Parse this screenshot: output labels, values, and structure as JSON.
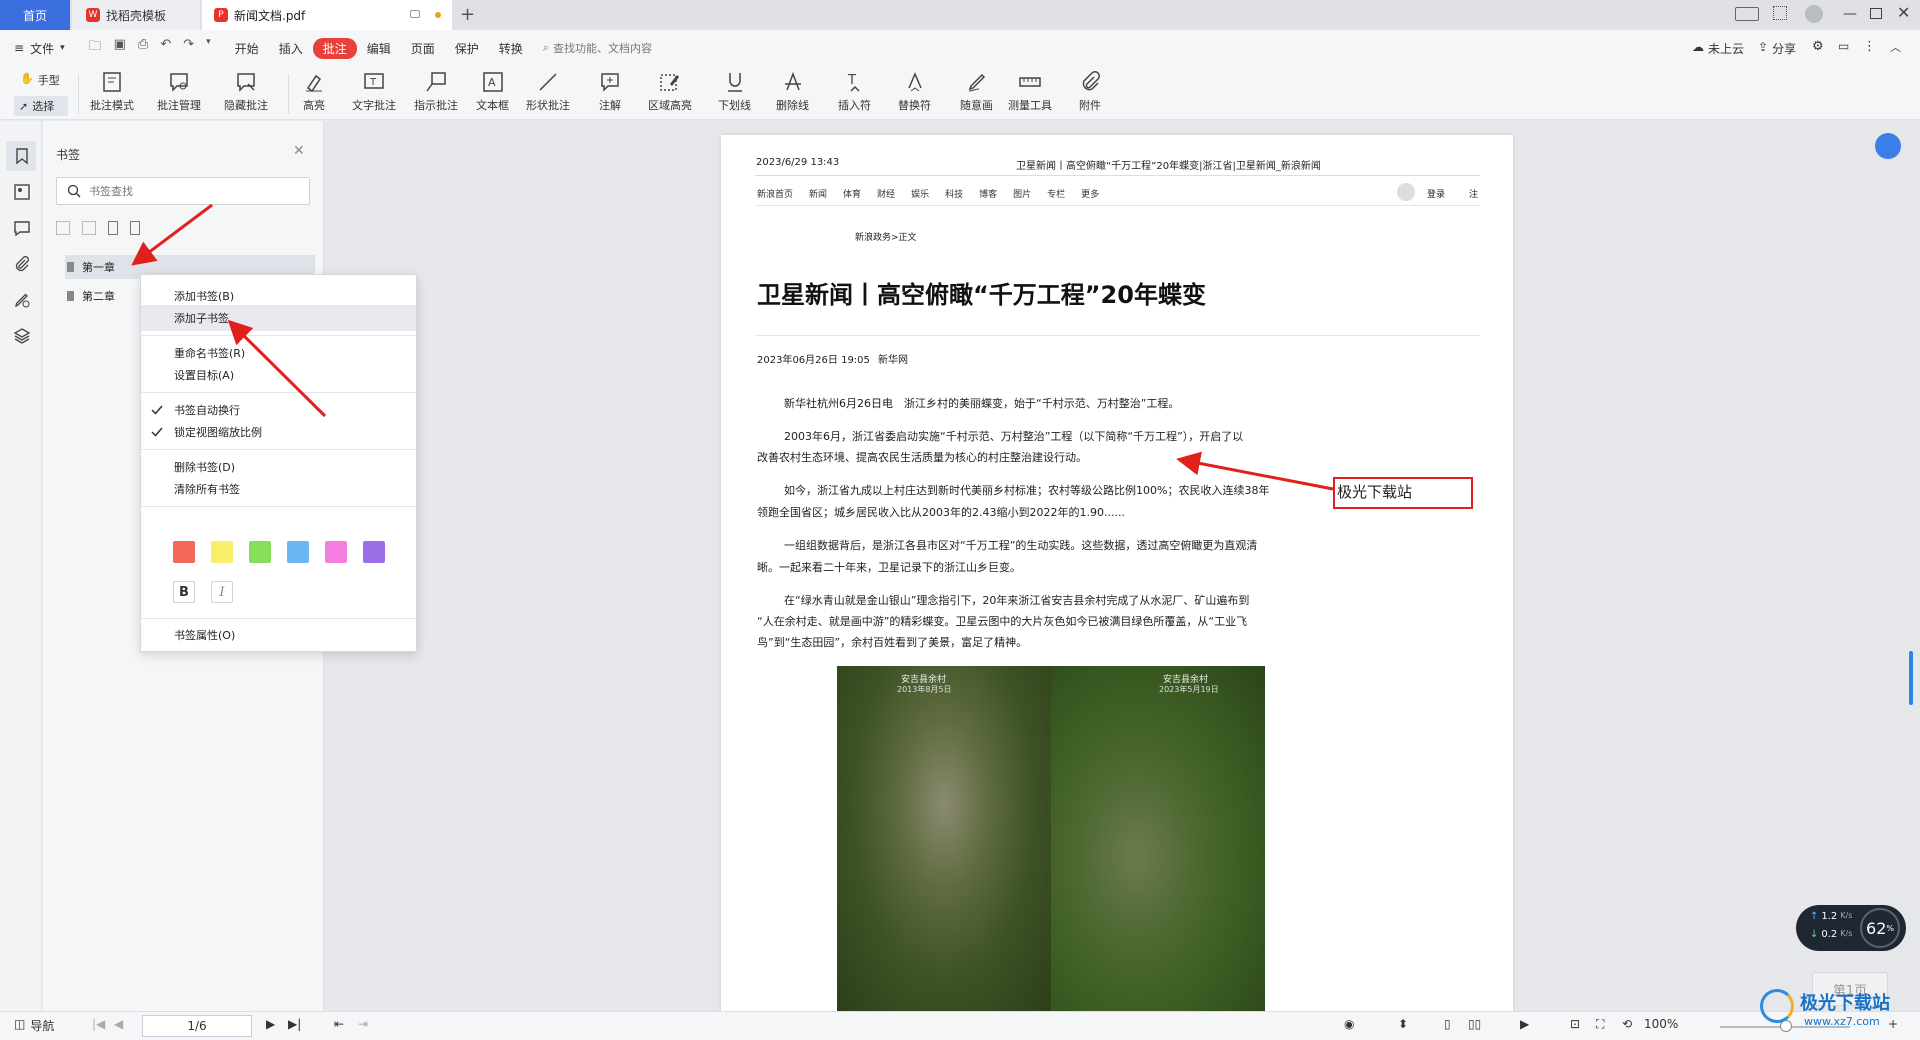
{
  "tabs": {
    "home": "首页",
    "template": "找稻壳模板",
    "document": "新闻文档.pdf"
  },
  "menubar": {
    "file": "文件",
    "items": [
      "开始",
      "插入",
      "批注",
      "编辑",
      "页面",
      "保护",
      "转换"
    ],
    "active": "批注",
    "search_placeholder": "查找功能、文档内容",
    "cloud": "未上云",
    "share": "分享"
  },
  "ribbon": {
    "hand": "手型",
    "select": "选择",
    "tools": [
      "批注模式",
      "批注管理",
      "隐藏批注",
      "高亮",
      "文字批注",
      "指示批注",
      "文本框",
      "形状批注",
      "注解",
      "区域高亮",
      "下划线",
      "删除线",
      "插入符",
      "替换符",
      "随意画",
      "测量工具",
      "附件"
    ]
  },
  "bookmark_panel": {
    "title": "书签",
    "search_placeholder": "书签查找",
    "items": [
      "第一章",
      "第二章"
    ]
  },
  "context_menu": {
    "add_bookmark": "添加书签(B)",
    "add_child": "添加子书签",
    "rename": "重命名书签(R)",
    "set_target": "设置目标(A)",
    "auto_wrap": "书签自动换行",
    "lock_zoom": "锁定视图缩放比例",
    "delete": "删除书签(D)",
    "clear_all": "清除所有书签",
    "bold": "B",
    "italic": "I",
    "properties": "书签属性(O)",
    "swatch_colors": [
      "#f4685a",
      "#f8ee6a",
      "#86e05a",
      "#6cb6f3",
      "#f37ee0",
      "#9b6ee8"
    ]
  },
  "page": {
    "header_date": "2023/6/29 13:43",
    "header_title": "卫星新闻丨高空俯瞰“千万工程”20年蝶变|浙江省|卫星新闻_新浪新闻",
    "nav": [
      "新浪首页",
      "新闻",
      "体育",
      "财经",
      "娱乐",
      "科技",
      "博客",
      "图片",
      "专栏",
      "更多"
    ],
    "login": "登录",
    "login2": "注",
    "breadcrumb": "新浪政务>正文",
    "headline": "卫星新闻丨高空俯瞰“千万工程”20年蝶变",
    "date": "2023年06月26日 19:05",
    "source": "新华网",
    "p1": "新华社杭州6月26日电　浙江乡村的美丽蝶变，始于“千村示范、万村整治”工程。",
    "p2a": "2003年6月，浙江省委启动实施“千村示范、万村整治”工程（以下简称“千万工程”），开启了以",
    "p2b": "改善农村生态环境、提高农民生活质量为核心的村庄整治建设行动。",
    "p3a": "如今，浙江省九成以上村庄达到新时代美丽乡村标准；农村等级公路比例100%；农民收入连续38年",
    "p3b": "领跑全国省区；城乡居民收入比从2003年的2.43缩小到2022年的1.90......",
    "p4a": "一组组数据背后，是浙江各县市区对“千万工程”的生动实践。这些数据，透过高空俯瞰更为直观清",
    "p4b": "晰。一起来看二十年来，卫星记录下的浙江山乡巨变。",
    "p5a": "在“绿水青山就是金山银山”理念指引下，20年来浙江省安吉县余村完成了从水泥厂、矿山遍布到",
    "p5b": "“人在余村走、就是画中游”的精彩蝶变。卫星云图中的大片灰色如今已被满目绿色所覆盖，从“工业飞",
    "p5c": "鸟”到“生态田园”，余村百姓看到了美景，富足了精神。",
    "img_label_left": "安吉县余村",
    "img_date_left": "2013年8月5日",
    "img_label_right": "安吉县余村",
    "img_date_right": "2023年5月19日",
    "annotation": "极光下载站"
  },
  "status": {
    "nav": "导航",
    "page": "1/6",
    "zoom": "100%",
    "first_page": "第1页"
  },
  "net": {
    "up": "1.2",
    "down": "0.2",
    "unit": "K/s",
    "percent": "62",
    "percent_unit": "%"
  },
  "watermark": {
    "name": "极光下载站",
    "url": "www.xz7.com"
  }
}
